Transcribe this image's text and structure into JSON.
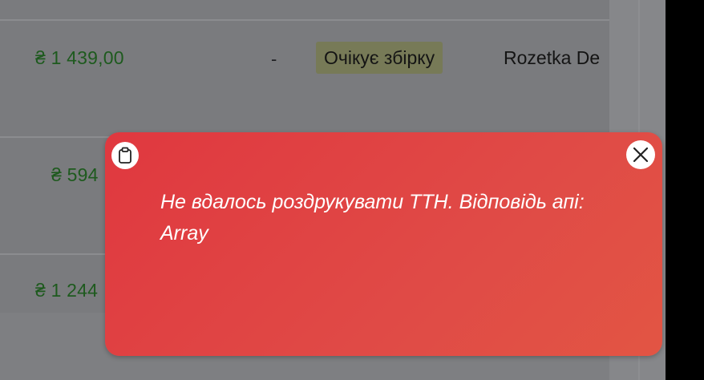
{
  "orders": {
    "rows": [
      {
        "price": "₴ 1 439,00",
        "dash": "-",
        "status": "Очікує збірку",
        "carrier": "Rozetka De"
      },
      {
        "price": "₴ 594"
      },
      {
        "price": "₴ 1 244"
      }
    ]
  },
  "toast": {
    "message": "Не вдалось роздрукувати ТТН. Відповідь апі: Array",
    "copy_icon": "clipboard-icon",
    "close_icon": "close-icon",
    "background": "#e0413f"
  },
  "colors": {
    "price": "#1e5a1e",
    "status_badge": "#777a57",
    "overlay": "#7e7f82"
  }
}
